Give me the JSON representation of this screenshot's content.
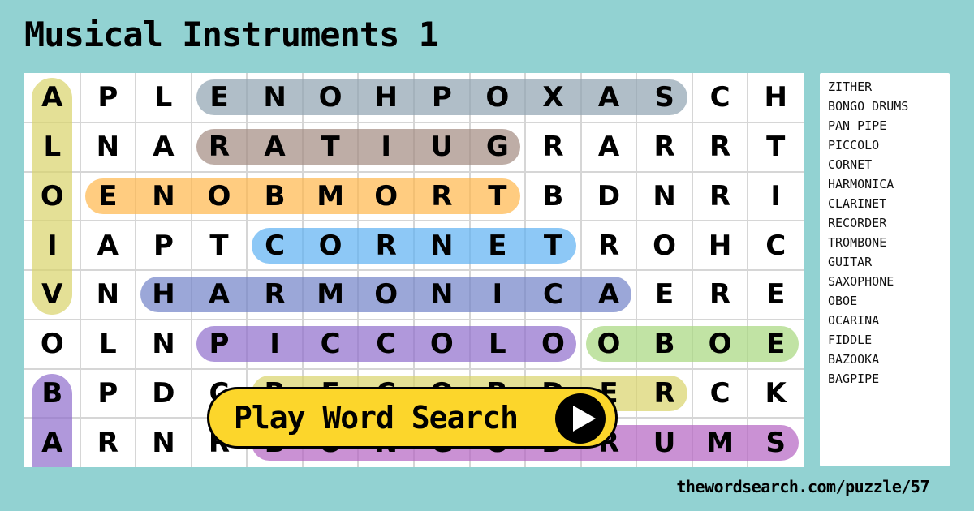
{
  "title": "Musical Instruments 1",
  "grid": {
    "rows": [
      [
        "A",
        "P",
        "L",
        "E",
        "N",
        "O",
        "H",
        "P",
        "O",
        "X",
        "A",
        "S",
        "C",
        "H"
      ],
      [
        "L",
        "N",
        "A",
        "R",
        "A",
        "T",
        "I",
        "U",
        "G",
        "R",
        "A",
        "R",
        "R",
        "T"
      ],
      [
        "O",
        "E",
        "N",
        "O",
        "B",
        "M",
        "O",
        "R",
        "T",
        "B",
        "D",
        "N",
        "R",
        "I"
      ],
      [
        "I",
        "A",
        "P",
        "T",
        "C",
        "O",
        "R",
        "N",
        "E",
        "T",
        "R",
        "O",
        "H",
        "C"
      ],
      [
        "V",
        "N",
        "H",
        "A",
        "R",
        "M",
        "O",
        "N",
        "I",
        "C",
        "A",
        "E",
        "R",
        "E"
      ],
      [
        "O",
        "L",
        "N",
        "P",
        "I",
        "C",
        "C",
        "O",
        "L",
        "O",
        "O",
        "B",
        "O",
        "E"
      ],
      [
        "B",
        "P",
        "D",
        "C",
        "R",
        "E",
        "C",
        "O",
        "R",
        "D",
        "E",
        "R",
        "C",
        "K"
      ],
      [
        "A",
        "R",
        "N",
        "R",
        "B",
        "O",
        "N",
        "G",
        "O",
        "D",
        "R",
        "U",
        "M",
        "S"
      ]
    ],
    "found": [
      {
        "word": "VIOLA",
        "dir": "vertical",
        "start": [
          0,
          0
        ],
        "end": [
          4,
          0
        ],
        "color": "#d9d36a"
      },
      {
        "word": "SAXOPHONE",
        "dir": "horizontal",
        "start": [
          0,
          3
        ],
        "end": [
          0,
          11
        ],
        "color": "#8ea3b0"
      },
      {
        "word": "GUITAR",
        "dir": "horizontal",
        "start": [
          1,
          3
        ],
        "end": [
          1,
          8
        ],
        "color": "#a38a80"
      },
      {
        "word": "TROMBONE",
        "dir": "horizontal",
        "start": [
          2,
          1
        ],
        "end": [
          2,
          8
        ],
        "color": "#ffb64a"
      },
      {
        "word": "CORNET",
        "dir": "horizontal",
        "start": [
          3,
          4
        ],
        "end": [
          3,
          9
        ],
        "color": "#5cb0f2"
      },
      {
        "word": "HARMONICA",
        "dir": "horizontal",
        "start": [
          4,
          2
        ],
        "end": [
          4,
          10
        ],
        "color": "#7081c8"
      },
      {
        "word": "PICCOLO",
        "dir": "horizontal",
        "start": [
          5,
          3
        ],
        "end": [
          5,
          9
        ],
        "color": "#8e6ccc"
      },
      {
        "word": "OBOE",
        "dir": "horizontal",
        "start": [
          5,
          10
        ],
        "end": [
          5,
          13
        ],
        "color": "#a6d77e"
      },
      {
        "word": "RECORDER",
        "dir": "horizontal",
        "start": [
          6,
          4
        ],
        "end": [
          6,
          11
        ],
        "color": "#d9d36a"
      },
      {
        "word": "BONGODRUMS",
        "dir": "horizontal",
        "start": [
          7,
          4
        ],
        "end": [
          7,
          13
        ],
        "color": "#b462c2"
      },
      {
        "word": "BA",
        "dir": "vertical",
        "start": [
          6,
          0
        ],
        "end": [
          7,
          0
        ],
        "color": "#8e6ccc"
      }
    ]
  },
  "word_list": [
    "ZITHER",
    "BONGO DRUMS",
    "PAN PIPE",
    "PICCOLO",
    "CORNET",
    "HARMONICA",
    "CLARINET",
    "RECORDER",
    "TROMBONE",
    "GUITAR",
    "SAXOPHONE",
    "OBOE",
    "OCARINA",
    "FIDDLE",
    "BAZOOKA",
    "BAGPIPE"
  ],
  "play_button": {
    "label": "Play Word Search",
    "icon": "play-icon"
  },
  "footer": {
    "url": "thewordsearch.com/puzzle/57"
  }
}
